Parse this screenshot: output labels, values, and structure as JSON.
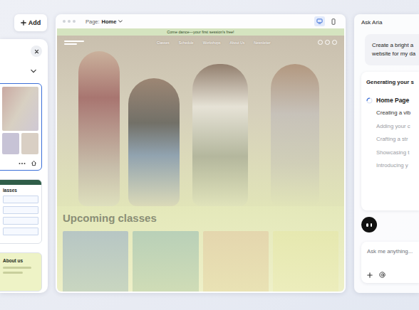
{
  "add_button": {
    "label": "Add"
  },
  "pages_panel": {
    "pages": [
      {
        "kind": "home",
        "title": "",
        "selected": true
      },
      {
        "kind": "list",
        "title": "lasses",
        "selected": false
      },
      {
        "kind": "about",
        "title": "About us",
        "selected": false
      }
    ]
  },
  "editor": {
    "page_label": "Page:",
    "page_name": "Home",
    "devices": [
      {
        "kind": "desktop",
        "selected": true
      },
      {
        "kind": "mobile",
        "selected": false
      }
    ]
  },
  "site": {
    "banner": "Come dance—your first session's free!",
    "nav": [
      "Classes",
      "Schedule",
      "Workshops",
      "About Us",
      "Newsletter"
    ],
    "section_title": "Upcoming classes"
  },
  "assistant": {
    "title": "Ask Aria",
    "prompt_lines": [
      "Create a bright a",
      "website for my da"
    ],
    "status": {
      "title": "Generating your s",
      "page": "Home Page",
      "steps": [
        {
          "label": "Creating a vib",
          "active": true
        },
        {
          "label": "Adding your c",
          "active": false
        },
        {
          "label": "Crafting a str",
          "active": false
        },
        {
          "label": "Showcasing t",
          "active": false
        },
        {
          "label": "Introducing y",
          "active": false
        }
      ]
    },
    "input": {
      "placeholder": "Ask me anything..."
    }
  }
}
